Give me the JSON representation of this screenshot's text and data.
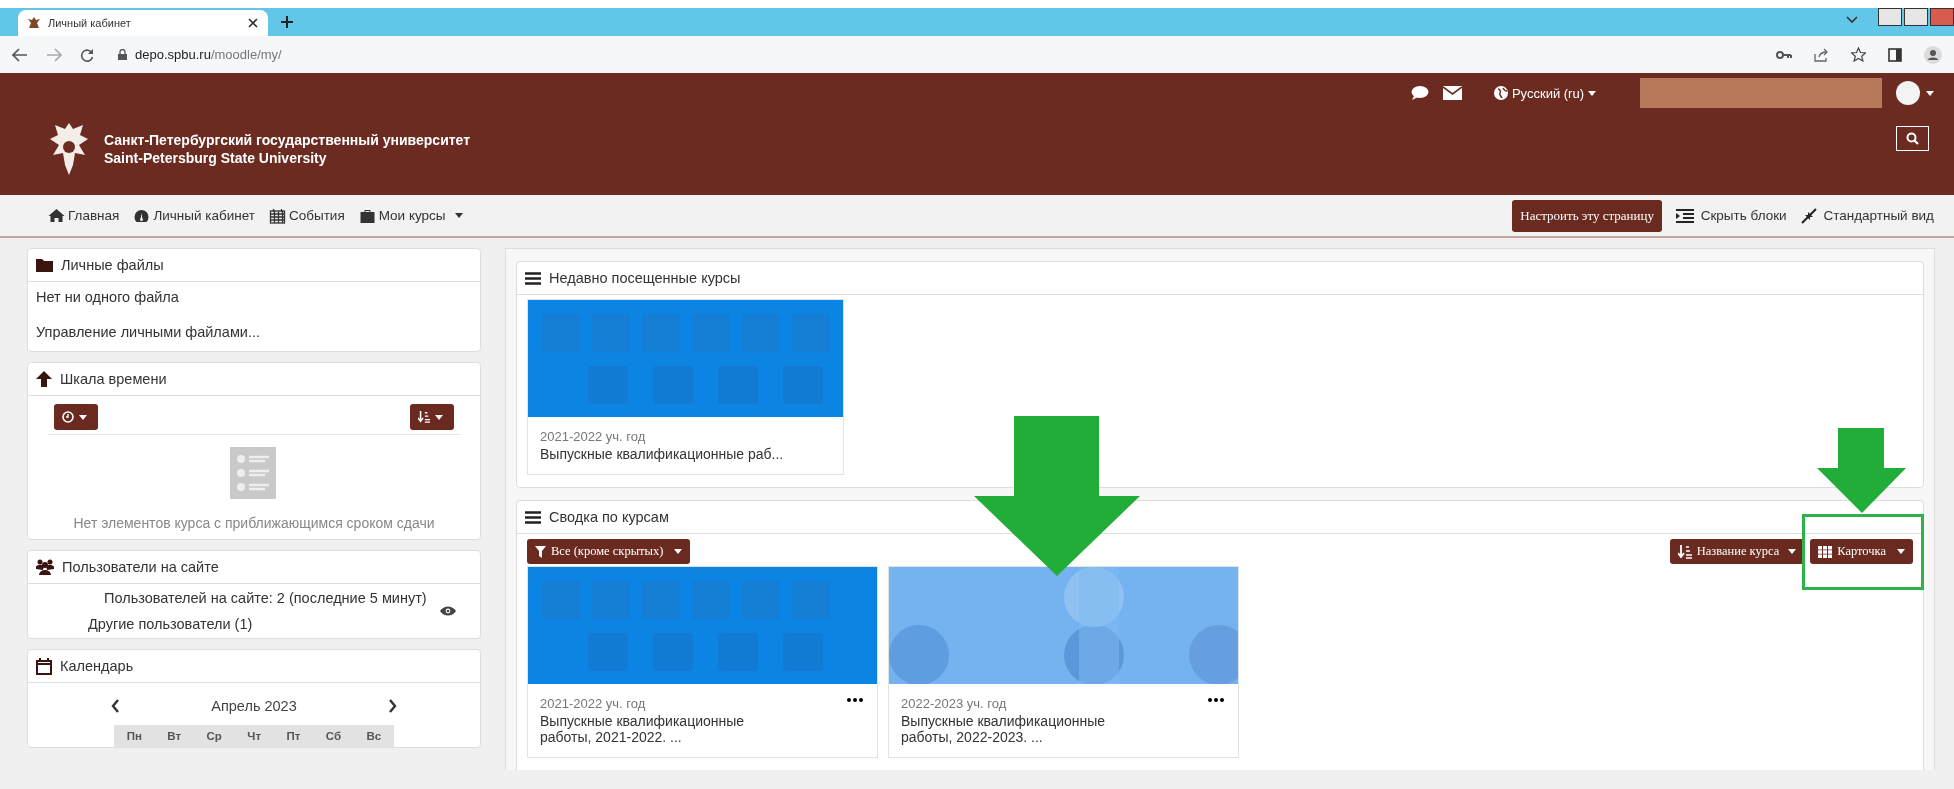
{
  "browser": {
    "tab": {
      "title": "Личный кабинет",
      "selected": true
    },
    "address": {
      "host": "depo.spbu.ru",
      "path": "/moodle/my/"
    }
  },
  "header": {
    "title_ru": "Санкт-Петербургский государственный университет",
    "title_en": "Saint-Petersburg State University",
    "language": "Русский (ru)"
  },
  "nav": {
    "items": [
      {
        "label": "Главная",
        "dropdown": false
      },
      {
        "label": "Личный кабинет",
        "dropdown": false
      },
      {
        "label": "События",
        "dropdown": false
      },
      {
        "label": "Мои курсы",
        "dropdown": true
      }
    ],
    "customize_button": "Настроить эту страницу",
    "hide_blocks": "Скрыть блоки",
    "standard_view": "Стандартный вид"
  },
  "sidebar": {
    "blocks": [
      {
        "kind": "files",
        "title": "Личные файлы",
        "lines": [
          "Нет ни одного файла",
          "Управление личными файлами..."
        ]
      },
      {
        "kind": "timeline",
        "title": "Шкала времени",
        "empty_text": "Нет элементов курса с приближающимся сроком сдачи"
      },
      {
        "kind": "online",
        "title": "Пользователи на сайте",
        "summary": "Пользователей на сайте: 2 (последние 5 минут)",
        "other": "Другие пользователи (1)"
      },
      {
        "kind": "calendar",
        "title": "Календарь",
        "month": "Апрель 2023",
        "weekdays": [
          "Пн",
          "Вт",
          "Ср",
          "Чт",
          "Пт",
          "Сб",
          "Вс"
        ]
      }
    ]
  },
  "recent": {
    "title": "Недавно посещенные курсы",
    "courses": [
      {
        "category": "2021-2022 уч. год",
        "name": "Выпускные квалификационные раб..."
      }
    ]
  },
  "overview": {
    "title": "Сводка по курсам",
    "filter": "Все (кроме скрытых)",
    "sort": "Название курса",
    "view": "Карточка",
    "courses": [
      {
        "category": "2021-2022 уч. год",
        "name": "Выпускные квалификационные работы, 2021-2022. ..."
      },
      {
        "category": "2022-2023 уч. год",
        "name": "Выпускные квалификационные работы, 2022-2023. ..."
      }
    ]
  }
}
